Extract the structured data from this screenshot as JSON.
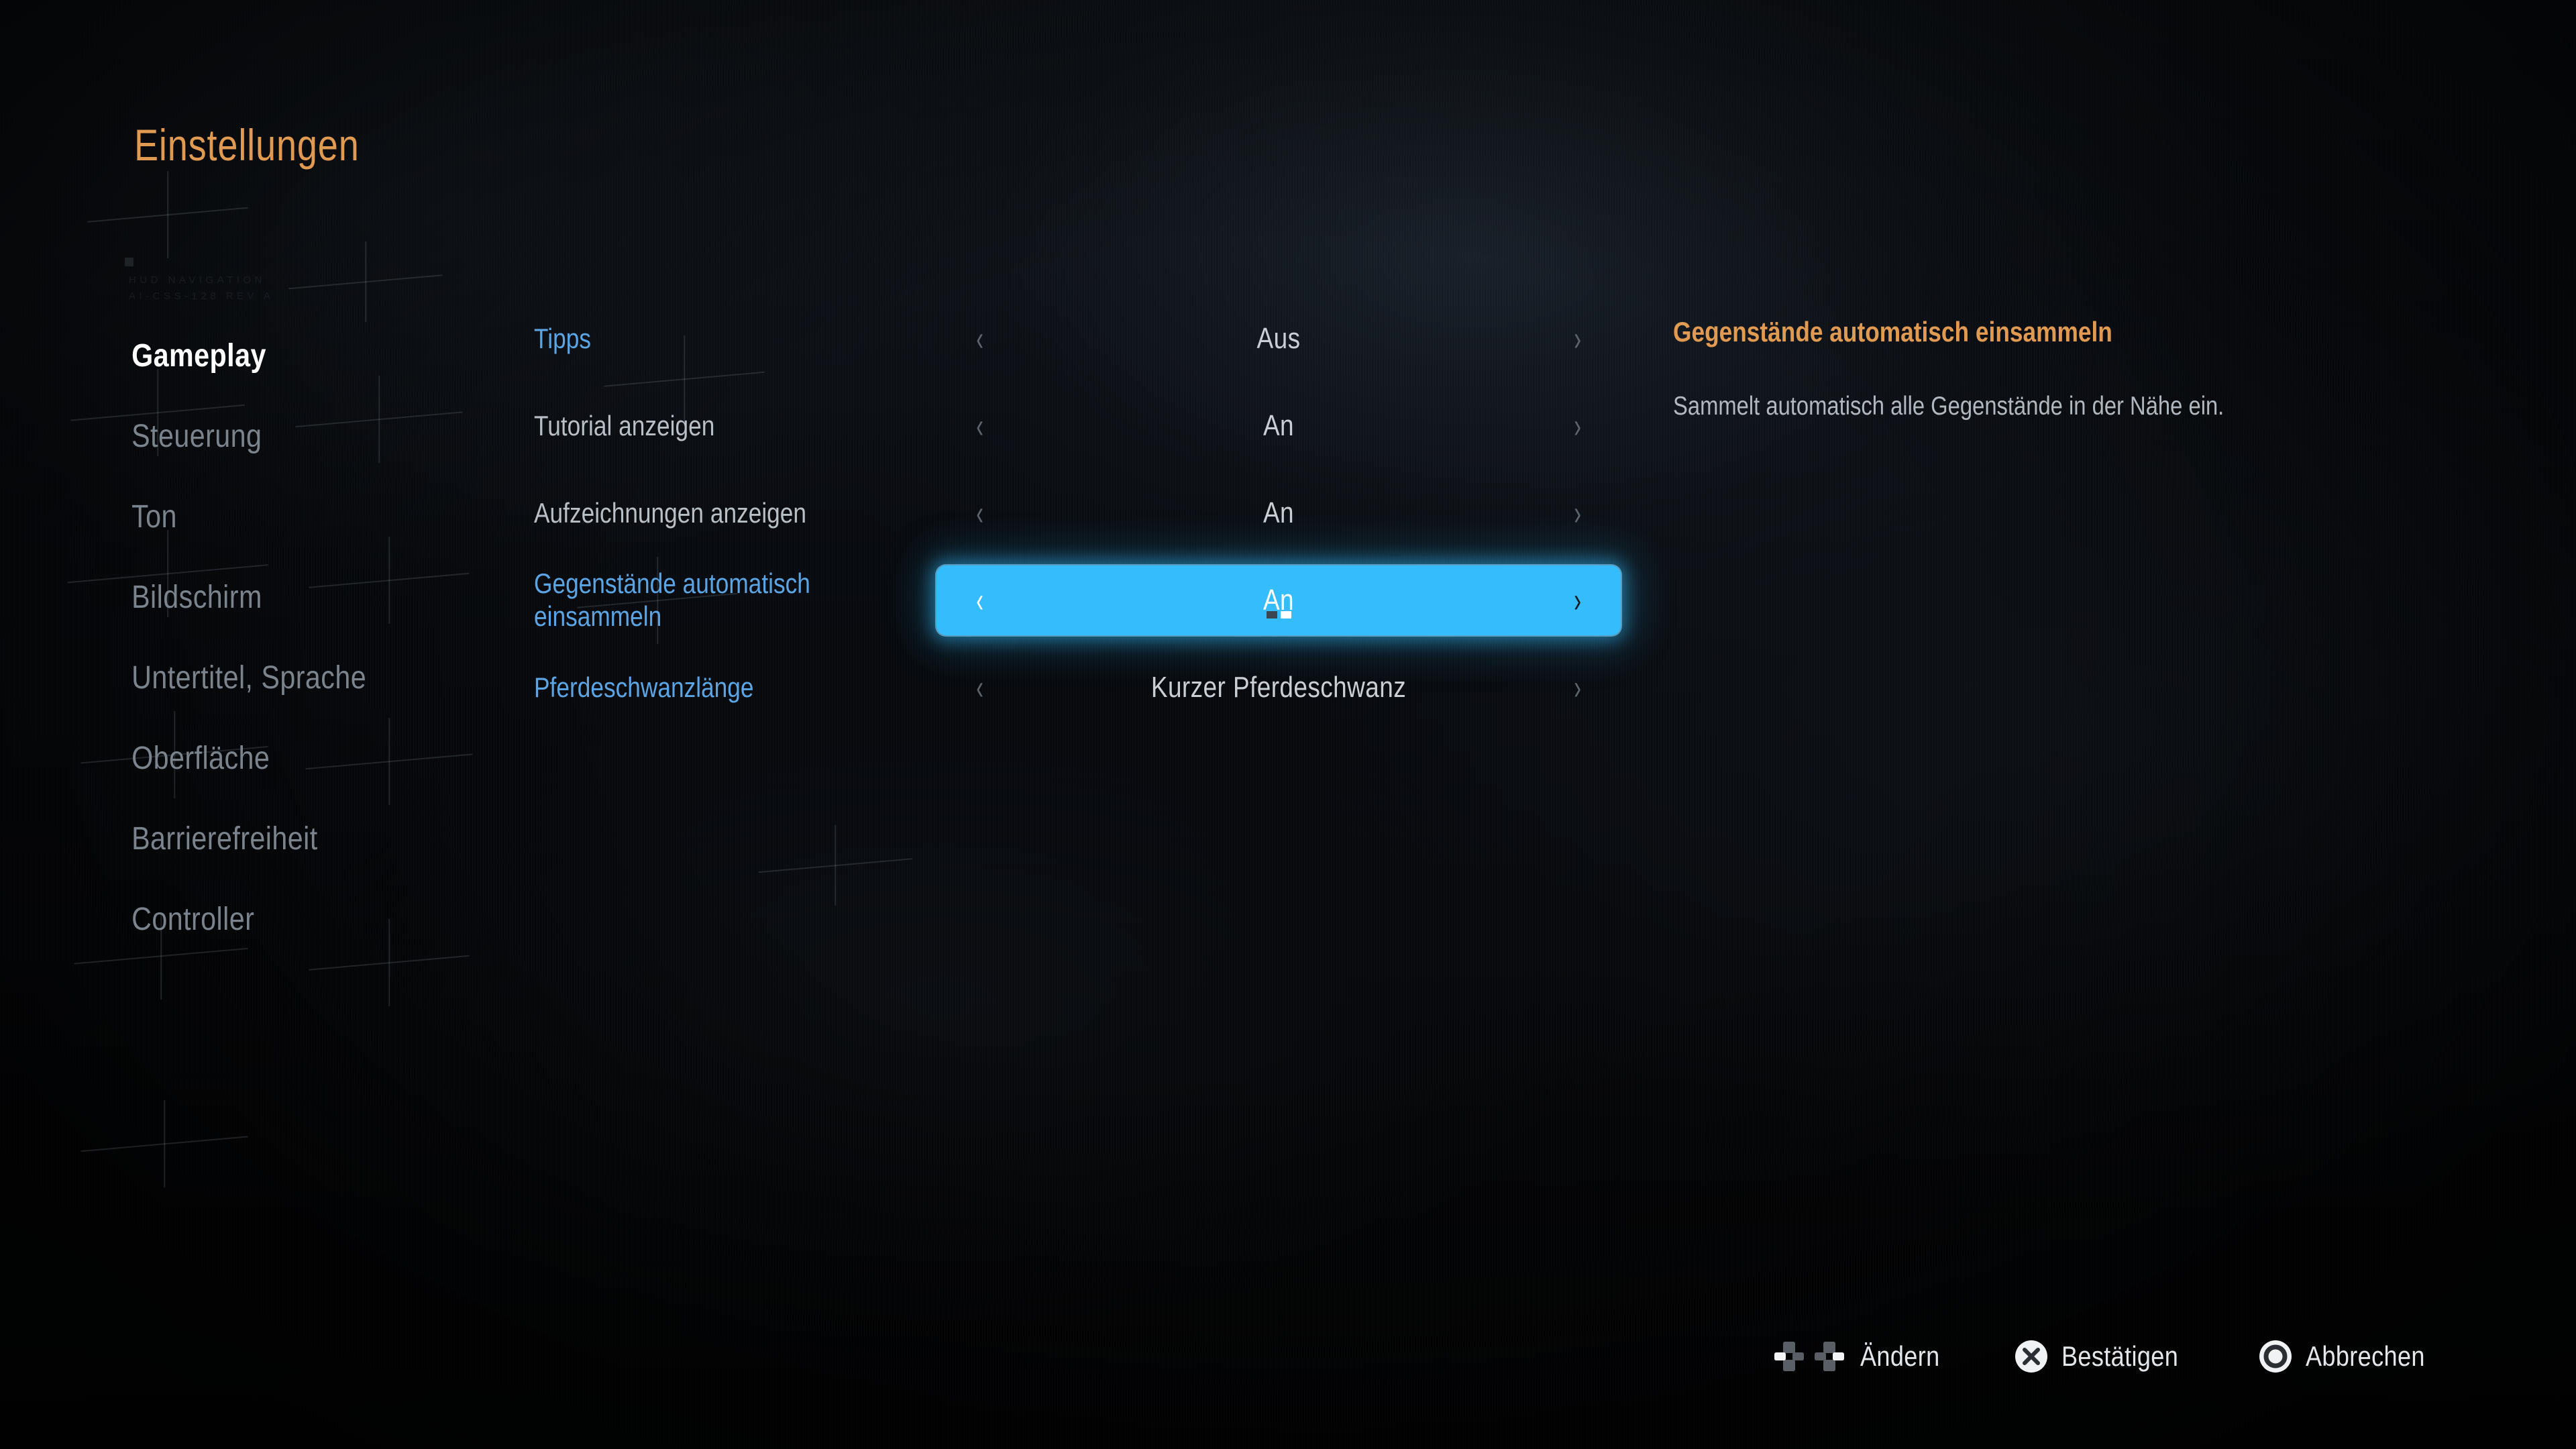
{
  "header": {
    "title": "Einstellungen",
    "accent_color": "#e09a51"
  },
  "decor": {
    "hud_line_1": "HUD NAVIGATION",
    "hud_line_2": "AI-CSS-128 REV A"
  },
  "sidebar": {
    "items": [
      {
        "label": "Gameplay",
        "active": true
      },
      {
        "label": "Steuerung",
        "active": false
      },
      {
        "label": "Ton",
        "active": false
      },
      {
        "label": "Bildschirm",
        "active": false
      },
      {
        "label": "Untertitel, Sprache",
        "active": false
      },
      {
        "label": "Oberfläche",
        "active": false
      },
      {
        "label": "Barrierefreiheit",
        "active": false
      },
      {
        "label": "Controller",
        "active": false
      }
    ]
  },
  "settings": {
    "rows": [
      {
        "label": "Tipps",
        "value": "Aus",
        "label_style": "blue",
        "selected": false
      },
      {
        "label": "Tutorial anzeigen",
        "value": "An",
        "label_style": "plain",
        "selected": false
      },
      {
        "label": "Aufzeichnungen anzeigen",
        "value": "An",
        "label_style": "plain",
        "selected": false
      },
      {
        "label": "Gegenstände automatisch einsammeln",
        "value": "An",
        "label_style": "blue",
        "selected": true,
        "option_index": 2,
        "option_count": 2
      },
      {
        "label": "Pferdeschwanzlänge",
        "value": "Kurzer Pferdeschwanz",
        "label_style": "blue",
        "selected": false
      }
    ],
    "prev_chevron": "‹",
    "next_chevron": "›",
    "selected_highlight_color": "#34bcfc"
  },
  "description": {
    "title": "Gegenstände automatisch einsammeln",
    "body": "Sammelt automatisch alle Gegenstände in der Nähe ein."
  },
  "footer": {
    "hints": [
      {
        "icon": "dpad-left-right-icon",
        "label": "Ändern"
      },
      {
        "icon": "cross-button-icon",
        "label": "Bestätigen"
      },
      {
        "icon": "circle-button-icon",
        "label": "Abbrechen"
      }
    ]
  }
}
